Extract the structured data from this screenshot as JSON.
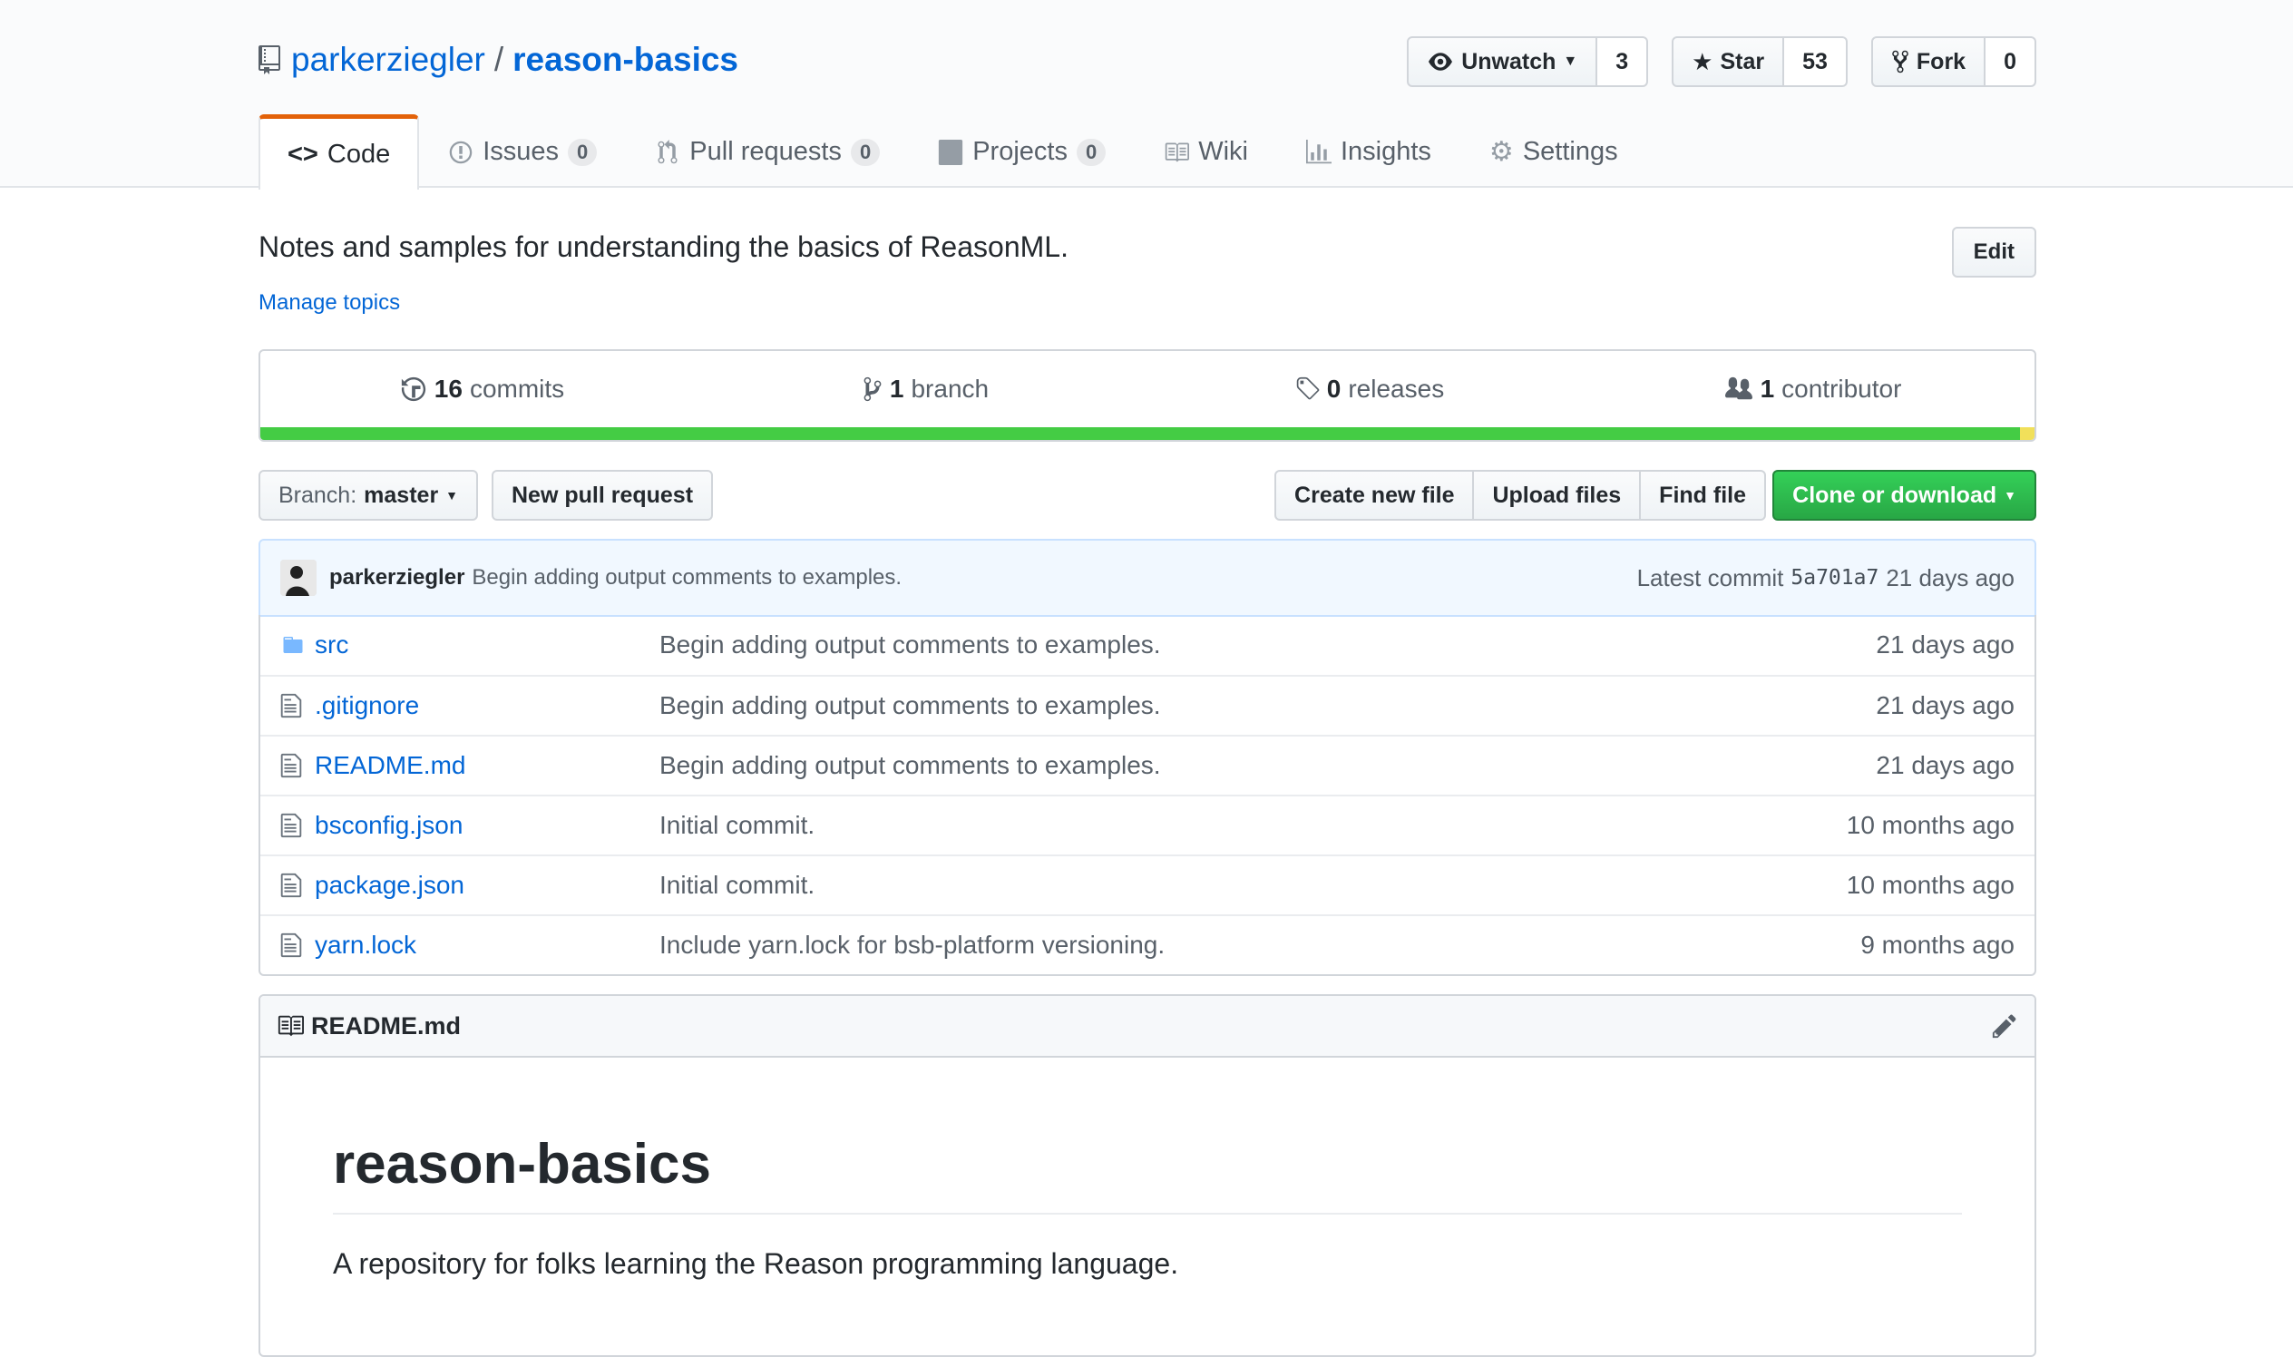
{
  "repo": {
    "owner": "parkerziegler",
    "separator": "/",
    "name": "reason-basics",
    "description": "Notes and samples for understanding the basics of ReasonML.",
    "manage_topics": "Manage topics",
    "edit_label": "Edit"
  },
  "actions": {
    "watch": {
      "label": "Unwatch",
      "count": "3"
    },
    "star": {
      "label": "Star",
      "count": "53"
    },
    "fork": {
      "label": "Fork",
      "count": "0"
    }
  },
  "tabs": [
    {
      "label": "Code",
      "count": null
    },
    {
      "label": "Issues",
      "count": "0"
    },
    {
      "label": "Pull requests",
      "count": "0"
    },
    {
      "label": "Projects",
      "count": "0"
    },
    {
      "label": "Wiki",
      "count": null
    },
    {
      "label": "Insights",
      "count": null
    },
    {
      "label": "Settings",
      "count": null
    }
  ],
  "summary": {
    "commits_num": "16",
    "commits_label": "commits",
    "branches_num": "1",
    "branches_label": "branch",
    "releases_num": "0",
    "releases_label": "releases",
    "contributors_num": "1",
    "contributors_label": "contributor"
  },
  "languages": {
    "primary_color": "#44cc44",
    "secondary_color": "#f1e05a"
  },
  "file_nav": {
    "branch_prefix": "Branch:",
    "branch_name": "master",
    "new_pr": "New pull request",
    "create_file": "Create new file",
    "upload_files": "Upload files",
    "find_file": "Find file",
    "clone": "Clone or download"
  },
  "latest_commit": {
    "author": "parkerziegler",
    "message": "Begin adding output comments to examples.",
    "label": "Latest commit",
    "sha": "5a701a7",
    "age": "21 days ago"
  },
  "files": [
    {
      "type": "dir",
      "name": "src",
      "message": "Begin adding output comments to examples.",
      "age": "21 days ago"
    },
    {
      "type": "file",
      "name": ".gitignore",
      "message": "Begin adding output comments to examples.",
      "age": "21 days ago"
    },
    {
      "type": "file",
      "name": "README.md",
      "message": "Begin adding output comments to examples.",
      "age": "21 days ago"
    },
    {
      "type": "file",
      "name": "bsconfig.json",
      "message": "Initial commit.",
      "age": "10 months ago"
    },
    {
      "type": "file",
      "name": "package.json",
      "message": "Initial commit.",
      "age": "10 months ago"
    },
    {
      "type": "file",
      "name": "yarn.lock",
      "message": "Include yarn.lock for bsb-platform versioning.",
      "age": "9 months ago"
    }
  ],
  "readme": {
    "filename": "README.md",
    "title": "reason-basics",
    "text": "A repository for folks learning the Reason programming language."
  }
}
